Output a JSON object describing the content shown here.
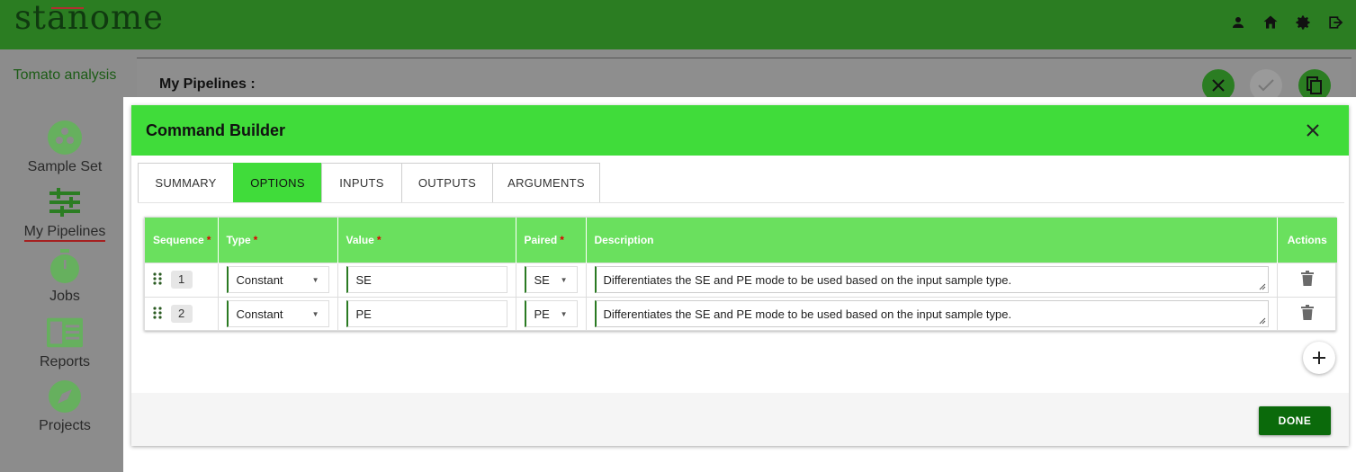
{
  "app": {
    "logo": "stanome"
  },
  "header_icons": [
    "person-icon",
    "home-icon",
    "gear-icon",
    "logout-icon"
  ],
  "sidebar": {
    "project": "Tomato analysis",
    "items": [
      {
        "label": "Sample Set",
        "icon": "sample-set-icon"
      },
      {
        "label": "My Pipelines",
        "icon": "sliders-icon",
        "active": true
      },
      {
        "label": "Jobs",
        "icon": "stopwatch-icon"
      },
      {
        "label": "Reports",
        "icon": "report-icon"
      },
      {
        "label": "Projects",
        "icon": "compass-icon"
      }
    ]
  },
  "background_page": {
    "title": "My Pipelines :"
  },
  "modal": {
    "title": "Command Builder",
    "tabs": [
      {
        "label": "SUMMARY"
      },
      {
        "label": "OPTIONS",
        "active": true
      },
      {
        "label": "INPUTS"
      },
      {
        "label": "OUTPUTS"
      },
      {
        "label": "ARGUMENTS"
      }
    ],
    "table": {
      "columns": [
        {
          "label": "Sequence",
          "required": true
        },
        {
          "label": "Type",
          "required": true
        },
        {
          "label": "Value",
          "required": true
        },
        {
          "label": "Paired",
          "required": true
        },
        {
          "label": "Description",
          "required": false
        },
        {
          "label": "Actions",
          "required": false
        }
      ],
      "required_mark": "*",
      "rows": [
        {
          "sequence": "1",
          "type": "Constant",
          "value": "SE",
          "paired": "SE",
          "description": "Differentiates the SE and PE mode to be used based on the input sample type."
        },
        {
          "sequence": "2",
          "type": "Constant",
          "value": "PE",
          "paired": "PE",
          "description": "Differentiates the SE and PE mode to be used based on the input sample type."
        }
      ]
    },
    "done_label": "DONE"
  },
  "colors": {
    "topbar": "#2b7d22",
    "modal_header": "#40dc3a",
    "table_header": "#6ae05e",
    "done_button": "#0b6a0b"
  }
}
